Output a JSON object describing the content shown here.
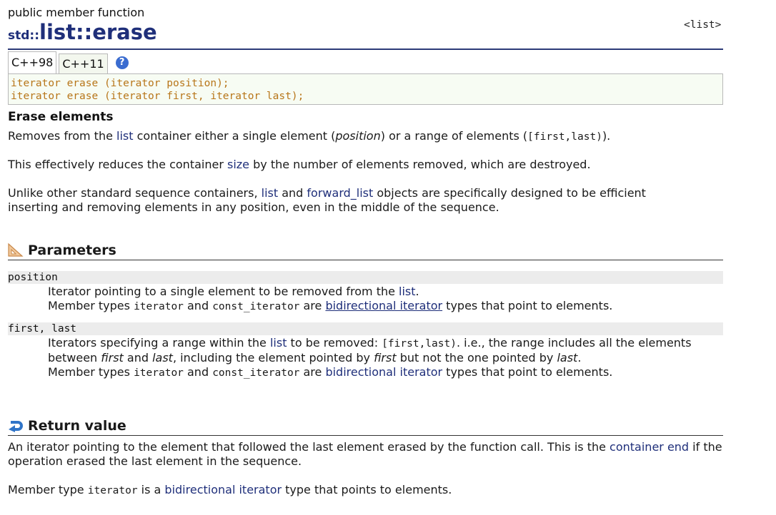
{
  "header": {
    "kind": "public member function",
    "ns": "std::",
    "name": "list::erase",
    "lib": "<list>"
  },
  "tabs": [
    {
      "label": "C++98",
      "active": true
    },
    {
      "label": "C++11",
      "active": false
    }
  ],
  "help_icon": "?",
  "prototypes": [
    "iterator erase (iterator position);",
    "iterator erase (iterator first, iterator last);"
  ],
  "section_title": "Erase elements",
  "intro": {
    "p1": {
      "a": "Removes from the ",
      "link_list": "list",
      "b": " container either a single element (",
      "position": "position",
      "c": ") or a range of elements (",
      "range": "[first,last)",
      "d": ")."
    },
    "p2": {
      "a": "This effectively reduces the container ",
      "link_size": "size",
      "b": " by the number of elements removed, which are destroyed."
    },
    "p3": {
      "a": "Unlike other standard sequence containers, ",
      "link_list": "list",
      "b": " and ",
      "link_fwd": "forward_list",
      "c": " objects are specifically designed to be efficient inserting and removing elements in any position, even in the middle of the sequence."
    }
  },
  "parameters": {
    "title": "Parameters",
    "position": {
      "name": "position",
      "l1a": "Iterator pointing to a single element to be removed from the ",
      "l1link": "list",
      "l1b": ".",
      "l2a": "Member types ",
      "t1": "iterator",
      "l2b": " and ",
      "t2": "const_iterator",
      "l2c": " are ",
      "l2link": "bidirectional iterator",
      "l2d": " types that point to elements."
    },
    "range": {
      "name": "first, last",
      "l1a": "Iterators specifying a range within the ",
      "l1link": "list",
      "l1b": " to be removed: ",
      "range": "[first,last)",
      "l1c": ". i.e., the range includes all the elements between ",
      "first": "first",
      "l1d": " and ",
      "last": "last",
      "l1e": ", including the element pointed by ",
      "first2": "first",
      "l1f": " but not the one pointed by ",
      "last2": "last",
      "l1g": ".",
      "l2a": "Member types ",
      "t1": "iterator",
      "l2b": " and ",
      "t2": "const_iterator",
      "l2c": " are ",
      "l2link": "bidirectional iterator",
      "l2d": " types that point to elements."
    }
  },
  "return": {
    "title": "Return value",
    "p1a": "An iterator pointing to the element that followed the last element erased by the function call. This is the ",
    "p1link": "container end",
    "p1b": " if the operation erased the last element in the sequence.",
    "p2a": "Member type ",
    "p2type": "iterator",
    "p2b": " is a ",
    "p2link": "bidirectional iterator",
    "p2c": " type that points to elements."
  },
  "colors": {
    "link": "#1f2f7a",
    "proto_text": "#b8761a",
    "proto_bg": "#f7fcf3",
    "param_bg": "#ececec"
  }
}
